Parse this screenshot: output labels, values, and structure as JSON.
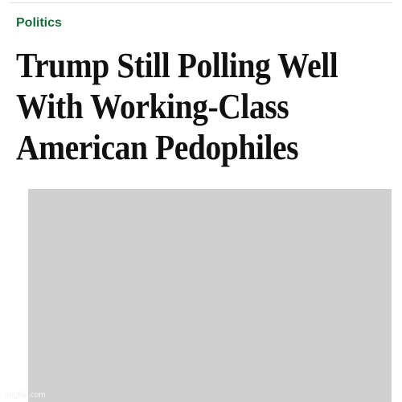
{
  "article": {
    "section": "Politics",
    "headline_lines": [
      "Trump Still Polling Well",
      "With Working-Class",
      "American Pedophiles"
    ]
  },
  "watermark": "imgflip.com",
  "colors": {
    "section": "#1d6b3a",
    "headline": "#111111"
  }
}
